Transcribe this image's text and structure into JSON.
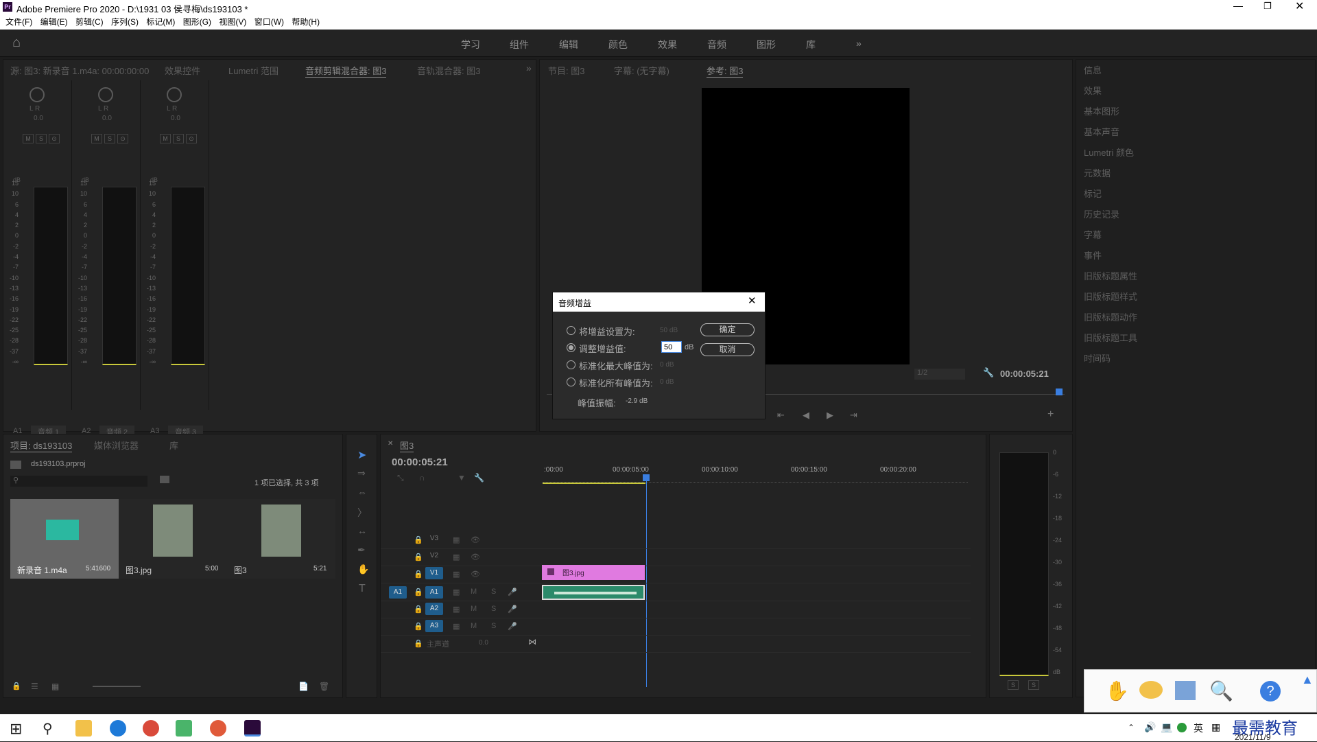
{
  "window": {
    "title": "Adobe Premiere Pro 2020 - D:\\1931 03 侯寻梅\\ds193103 *",
    "app_icon": "Pr"
  },
  "menu": [
    "文件(F)",
    "编辑(E)",
    "剪辑(C)",
    "序列(S)",
    "标记(M)",
    "图形(G)",
    "视图(V)",
    "窗口(W)",
    "帮助(H)"
  ],
  "workspaces": [
    "学习",
    "组件",
    "编辑",
    "颜色",
    "效果",
    "音频",
    "图形",
    "库"
  ],
  "source_panel": {
    "tabs": [
      "源: 图3: 新录音 1.m4a: 00:00:00:00",
      "效果控件",
      "Lumetri 范围",
      "音频剪辑混合器: 图3",
      "音轨混合器: 图3"
    ],
    "channels": [
      {
        "lr": "L R",
        "value": "0.0",
        "id": "A1",
        "name": "音频 1"
      },
      {
        "lr": "L R",
        "value": "0.0",
        "id": "A2",
        "name": "音频 2"
      },
      {
        "lr": "L R",
        "value": "0.0",
        "id": "A3",
        "name": "音频 3"
      }
    ],
    "db_label": "dB",
    "scale": [
      "15",
      "10",
      "6",
      "4",
      "2",
      "0",
      "-2",
      "-4",
      "-7",
      "-10",
      "-13",
      "-16",
      "-19",
      "-22",
      "-25",
      "-28",
      "-37",
      "-∞"
    ],
    "ms": [
      "M",
      "S",
      "⊙"
    ]
  },
  "program_panel": {
    "tabs": [
      "节目: 图3",
      "字幕: (无字幕)",
      "参考: 图3"
    ],
    "timecode": "00:00:05:21",
    "zoom": "1/2"
  },
  "right_panel": [
    "信息",
    "效果",
    "基本图形",
    "基本声音",
    "Lumetri 颜色",
    "元数据",
    "标记",
    "历史记录",
    "字幕",
    "事件",
    "旧版标题属性",
    "旧版标题样式",
    "旧版标题动作",
    "旧版标题工具",
    "时间码"
  ],
  "project_panel": {
    "tabs": [
      "项目: ds193103",
      "媒体浏览器",
      "库"
    ],
    "file": "ds193103.prproj",
    "selection": "1 项已选择, 共 3 项",
    "items": [
      {
        "name": "新录音 1.m4a",
        "duration": "5:41600"
      },
      {
        "name": "图3.jpg",
        "duration": "5:00"
      },
      {
        "name": "图3",
        "duration": "5:21"
      }
    ]
  },
  "timeline": {
    "tab": "图3",
    "timecode": "00:00:05:21",
    "ruler": [
      ":00:00",
      "00:00:05:00",
      "00:00:10:00",
      "00:00:15:00",
      "00:00:20:00"
    ],
    "video_tracks": [
      "V3",
      "V2",
      "V1"
    ],
    "audio_tracks": [
      "A1",
      "A2",
      "A3"
    ],
    "source_patch": "A1",
    "master": {
      "label": "主声道",
      "value": "0.0"
    },
    "video_clip": "图3.jpg"
  },
  "audio_meter": {
    "scale": [
      "0",
      "-6",
      "-12",
      "-18",
      "-24",
      "-30",
      "-36",
      "-42",
      "-48",
      "-54",
      "dB"
    ],
    "solo": [
      "S",
      "S"
    ]
  },
  "dialog": {
    "title": "音频增益",
    "options": [
      {
        "label": "将增益设置为:",
        "value": "50 dB",
        "selected": false
      },
      {
        "label": "调整增益值:",
        "value": "50",
        "unit": "dB",
        "selected": true
      },
      {
        "label": "标准化最大峰值为:",
        "value": "0 dB",
        "selected": false
      },
      {
        "label": "标准化所有峰值为:",
        "value": "0 dB",
        "selected": false
      }
    ],
    "peak_label": "峰值振幅:",
    "peak_value": "-2.9 dB",
    "ok": "确定",
    "cancel": "取消"
  },
  "taskbar": {
    "ime": "英",
    "date": "2021/11/9",
    "watermark": "最需教育"
  }
}
